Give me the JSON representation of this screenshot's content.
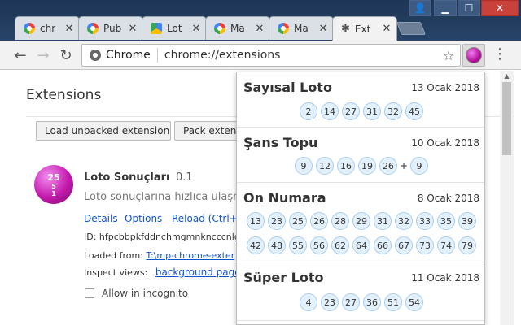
{
  "tabs": [
    {
      "label": "chr",
      "icon": "google-icon"
    },
    {
      "label": "Pub",
      "icon": "google-icon"
    },
    {
      "label": "Lot",
      "icon": "drive-icon"
    },
    {
      "label": "Ma",
      "icon": "google-icon"
    },
    {
      "label": "Ma",
      "icon": "google-icon"
    },
    {
      "label": "Ext",
      "icon": "puzzle-icon",
      "active": true
    }
  ],
  "omnibox": {
    "scheme_label": "Chrome",
    "url": "chrome://extensions"
  },
  "page": {
    "title": "Extensions",
    "load_unpacked": "Load unpacked extension...",
    "pack_extension": "Pack extensi",
    "extension": {
      "name": "Loto Sonuçları",
      "version": "0.1",
      "description": "Loto sonuçlarına hızlıca ulaşmanı",
      "details": "Details",
      "options": "Options",
      "reload": "Reload (Ctrl+R)",
      "id": "ID: hfpcbbpkfddnchmgmnkncccnlgc",
      "loaded_from_label": "Loaded from:",
      "loaded_from_path": "T:\\mp-chrome-exter",
      "inspect_label": "Inspect views:",
      "inspect_link": "background page",
      "incognito": "Allow in incognito",
      "icon_numbers": [
        "25",
        "5",
        "1"
      ]
    }
  },
  "popup": {
    "games": [
      {
        "name": "Sayısal Loto",
        "date": "13 Ocak 2018",
        "rows": [
          [
            "2",
            "14",
            "27",
            "31",
            "32",
            "45"
          ]
        ]
      },
      {
        "name": "Şans Topu",
        "date": "10 Ocak 2018",
        "rows": [
          [
            "9",
            "12",
            "16",
            "19",
            "26"
          ]
        ],
        "plus": "+",
        "extra": "9"
      },
      {
        "name": "On Numara",
        "date": "8 Ocak 2018",
        "rows": [
          [
            "13",
            "23",
            "25",
            "26",
            "28",
            "29",
            "31",
            "32",
            "33",
            "35",
            "39"
          ],
          [
            "42",
            "48",
            "55",
            "56",
            "62",
            "64",
            "66",
            "67",
            "73",
            "74",
            "79"
          ]
        ]
      },
      {
        "name": "Süper Loto",
        "date": "11 Ocak 2018",
        "rows": [
          [
            "4",
            "23",
            "27",
            "36",
            "51",
            "54"
          ]
        ]
      }
    ]
  },
  "colors": {
    "accent": "#1155cc",
    "ball_fill": "#e3f1fd",
    "ball_border": "#a9cdee",
    "close_button": "#c8413a"
  }
}
